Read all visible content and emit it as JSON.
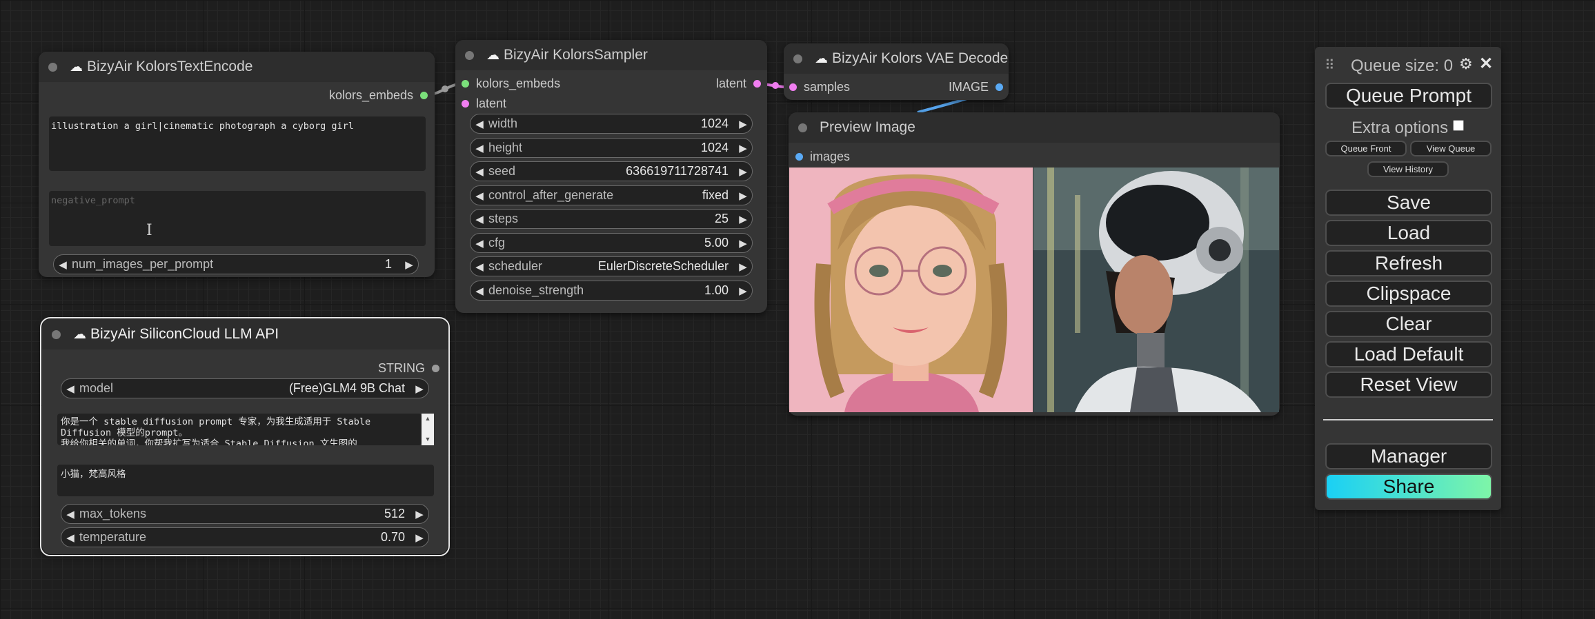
{
  "nodes": {
    "text_encode": {
      "title": "BizyAir KolorsTextEncode",
      "output": "kolors_embeds",
      "prompt": "illustration a girl|cinematic photograph a cyborg girl",
      "negative_placeholder": "negative_prompt",
      "widget": {
        "name": "num_images_per_prompt",
        "value": "1"
      }
    },
    "sampler": {
      "title": "BizyAir KolorsSampler",
      "inputs": [
        "kolors_embeds",
        "latent"
      ],
      "output": "latent",
      "widgets": [
        {
          "name": "width",
          "value": "1024"
        },
        {
          "name": "height",
          "value": "1024"
        },
        {
          "name": "seed",
          "value": "636619711728741"
        },
        {
          "name": "control_after_generate",
          "value": "fixed"
        },
        {
          "name": "steps",
          "value": "25"
        },
        {
          "name": "cfg",
          "value": "5.00"
        },
        {
          "name": "scheduler",
          "value": "EulerDiscreteScheduler"
        },
        {
          "name": "denoise_strength",
          "value": "1.00"
        }
      ]
    },
    "vae_decode": {
      "title": "BizyAir Kolors VAE Decode",
      "input": "samples",
      "output": "IMAGE"
    },
    "preview": {
      "title": "Preview Image",
      "input": "images"
    },
    "llm": {
      "title": "BizyAir SiliconCloud LLM API",
      "output": "STRING",
      "model": {
        "name": "model",
        "value": "(Free)GLM4 9B Chat"
      },
      "system_prompt": "你是一个 stable diffusion prompt 专家，为我生成适用于 Stable Diffusion 模型的prompt。\n我给你相关的单词，你帮我扩写为适合 Stable Diffusion 文生图的",
      "user_prompt": "小猫，梵高风格",
      "widgets": [
        {
          "name": "max_tokens",
          "value": "512"
        },
        {
          "name": "temperature",
          "value": "0.70"
        }
      ]
    }
  },
  "queue_panel": {
    "queue_size": "Queue size: 0",
    "queue_prompt": "Queue Prompt",
    "extra_options": "Extra options",
    "queue_front": "Queue Front",
    "view_queue": "View Queue",
    "view_history": "View History",
    "buttons": [
      "Save",
      "Load",
      "Refresh",
      "Clipspace",
      "Clear",
      "Load Default",
      "Reset View"
    ],
    "manager": "Manager",
    "share": "Share"
  },
  "colors": {
    "canvas": "#1e1e1e",
    "node_body": "#353535",
    "node_title": "#2d2d2d",
    "conditioning_link": "#7be07b",
    "latent_link": "#f07ef0",
    "image_link": "#5aaaf5",
    "share_gradient": [
      "#1ad0f5",
      "#7ef5a8"
    ]
  },
  "icons": {
    "node_badge": "cloud-icon",
    "settings": "gear-icon",
    "close": "close-icon",
    "drag": "drag-handle-icon",
    "decrement": "left-arrow-icon",
    "increment": "right-arrow-icon"
  }
}
